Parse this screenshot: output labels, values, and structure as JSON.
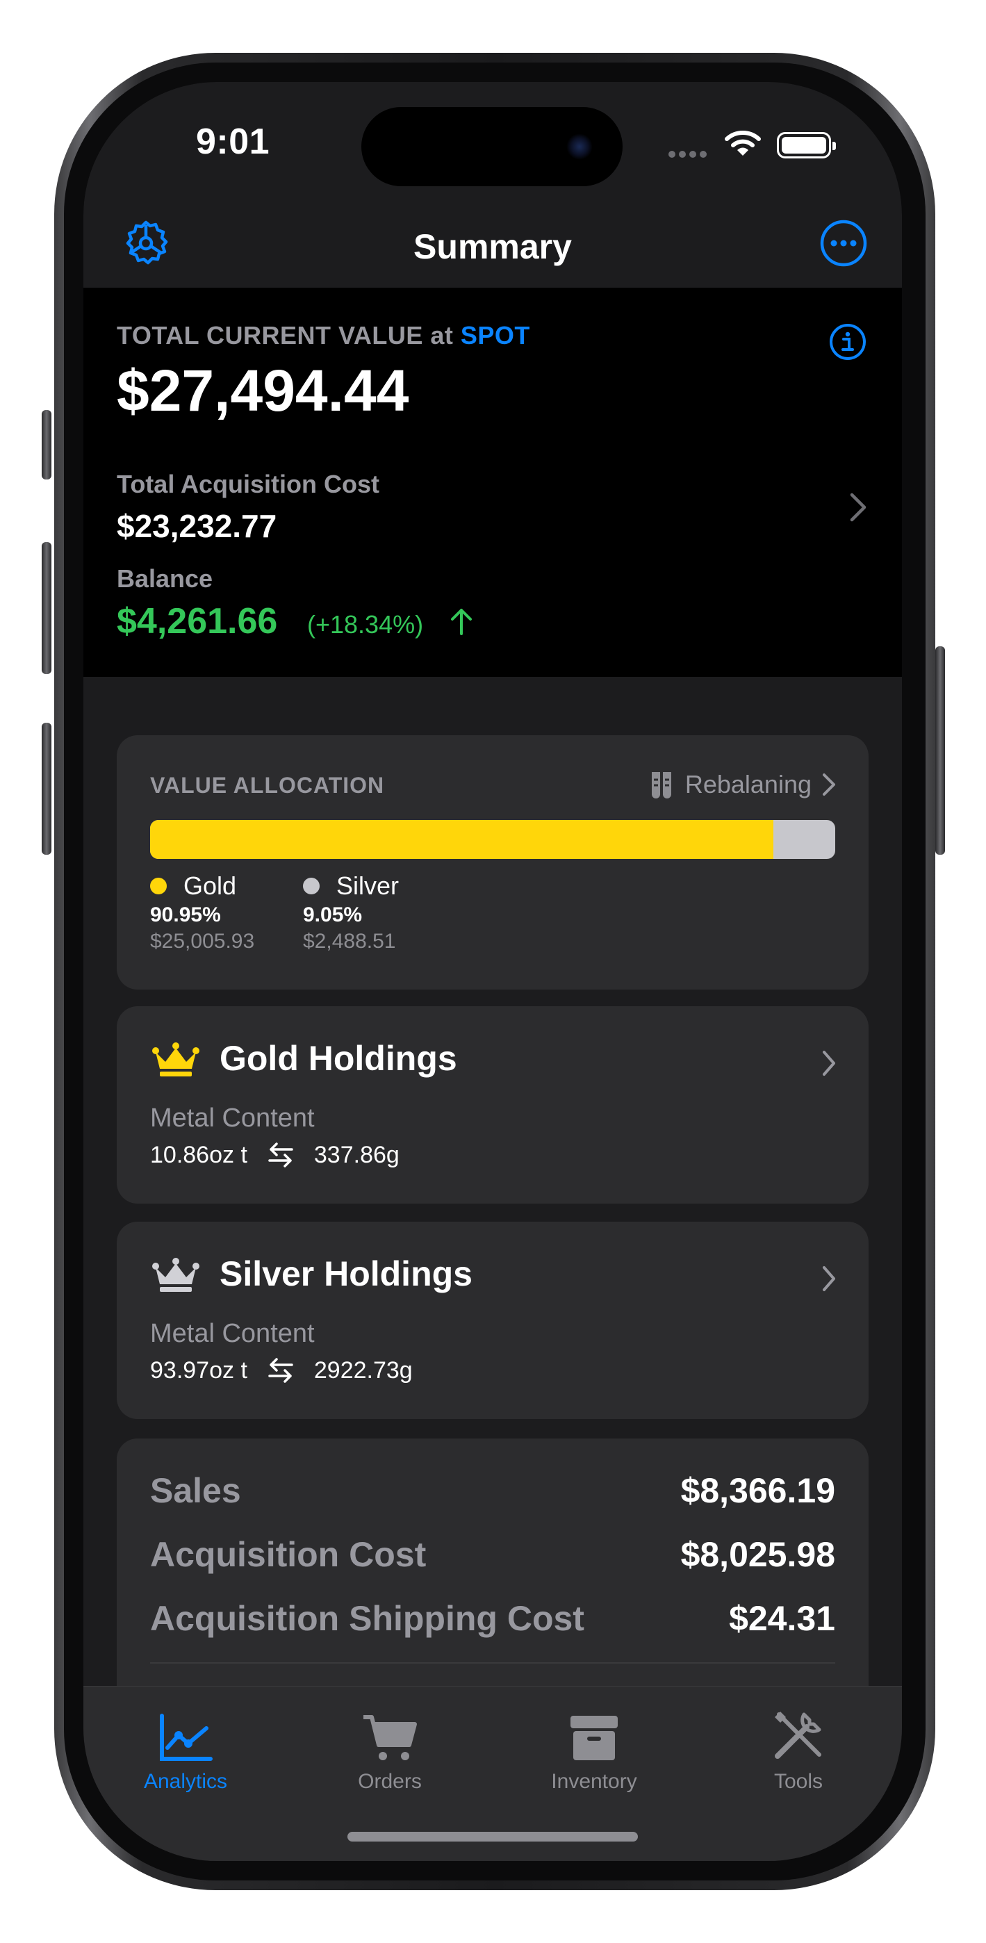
{
  "status": {
    "time": "9:01"
  },
  "nav": {
    "title": "Summary"
  },
  "header": {
    "tcv_label": "TOTAL CURRENT VALUE at",
    "tcv_mode": "SPOT",
    "tcv_value": "$27,494.44",
    "tac_label": "Total Acquisition Cost",
    "tac_value": "$23,232.77",
    "balance_label": "Balance",
    "balance_value": "$4,261.66",
    "balance_pct": "(+18.34%)"
  },
  "allocation": {
    "title": "VALUE ALLOCATION",
    "rebalance_label": "Rebalaning",
    "gold_fraction": 0.9095,
    "items": [
      {
        "name": "Gold",
        "pct": "90.95%",
        "amount": "$25,005.93",
        "color": "#ffd60a"
      },
      {
        "name": "Silver",
        "pct": "9.05%",
        "amount": "$2,488.51",
        "color": "#c7c7cc"
      }
    ]
  },
  "holdings": [
    {
      "title": "Gold Holdings",
      "label": "Metal Content",
      "oz": "10.86oz t",
      "grams": "337.86g",
      "crown_color": "#ffd60a"
    },
    {
      "title": "Silver Holdings",
      "label": "Metal Content",
      "oz": "93.97oz t",
      "grams": "2922.73g",
      "crown_color": "#d1d1d6"
    }
  ],
  "totals": [
    {
      "label": "Sales",
      "value": "$8,366.19"
    },
    {
      "label": "Acquisition Cost",
      "value": "$8,025.98"
    },
    {
      "label": "Acquisition Shipping Cost",
      "value": "$24.31"
    }
  ],
  "tabs": [
    {
      "label": "Analytics",
      "icon": "chart-icon",
      "active": true
    },
    {
      "label": "Orders",
      "icon": "cart-icon",
      "active": false
    },
    {
      "label": "Inventory",
      "icon": "archive-box-icon",
      "active": false
    },
    {
      "label": "Tools",
      "icon": "tools-icon",
      "active": false
    }
  ],
  "colors": {
    "accent": "#0a84ff",
    "positive": "#34c759",
    "gold": "#ffd60a",
    "silver": "#c7c7cc"
  }
}
